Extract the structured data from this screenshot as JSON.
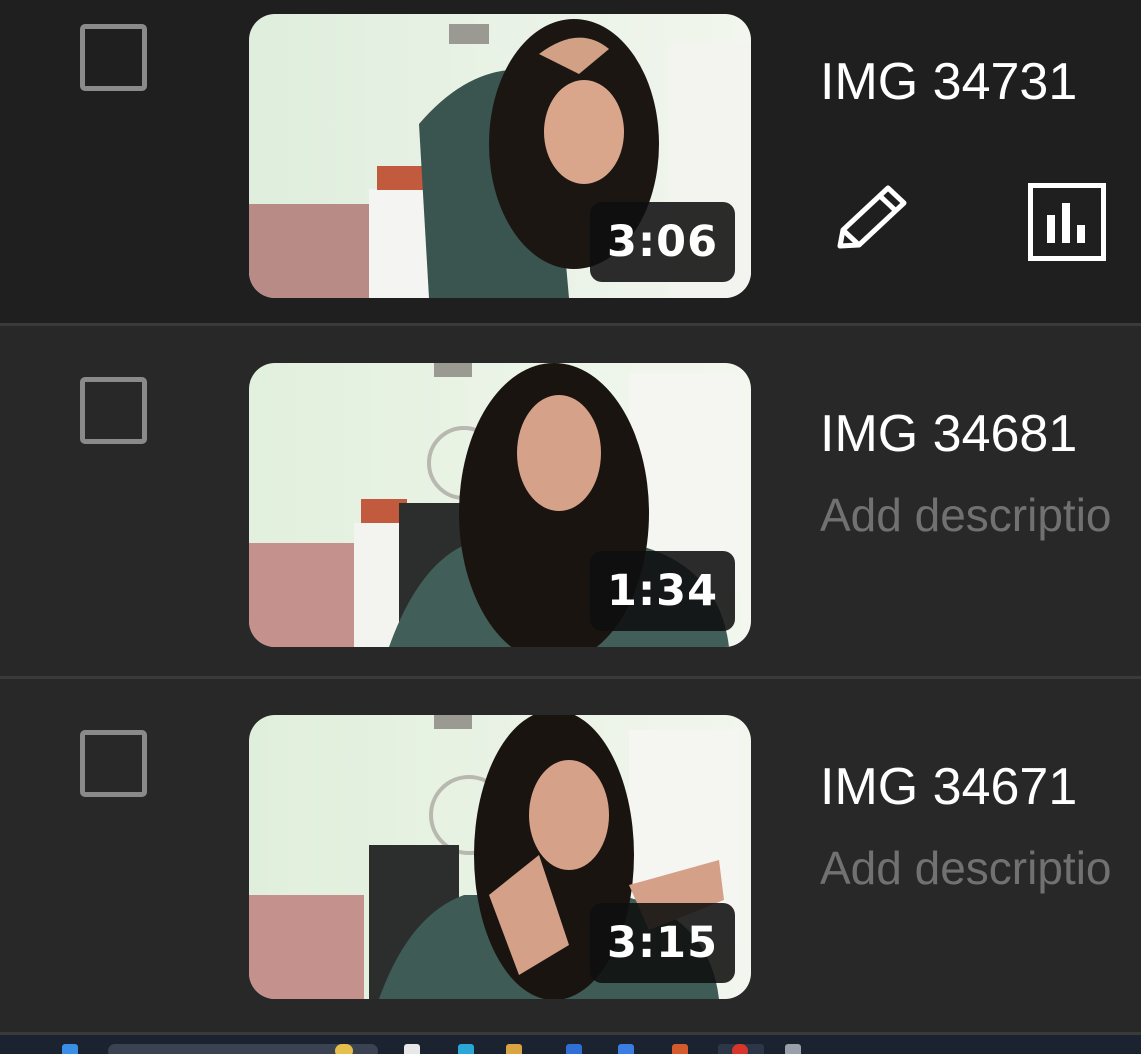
{
  "videos": [
    {
      "title": "IMG 34731",
      "duration": "3:06",
      "description": "",
      "hovered": true
    },
    {
      "title": "IMG 34681",
      "duration": "1:34",
      "description": "Add descriptio",
      "hovered": false
    },
    {
      "title": "IMG 34671",
      "duration": "3:15",
      "description": "Add descriptio",
      "hovered": false
    }
  ],
  "actions": {
    "edit_icon": "pencil-icon",
    "analytics_icon": "bar-chart-icon"
  },
  "colors": {
    "background": "#282828",
    "row_hover": "#1f1f1f",
    "title": "#ffffff",
    "description": "#717171",
    "checkbox": "#8a8a8a"
  }
}
